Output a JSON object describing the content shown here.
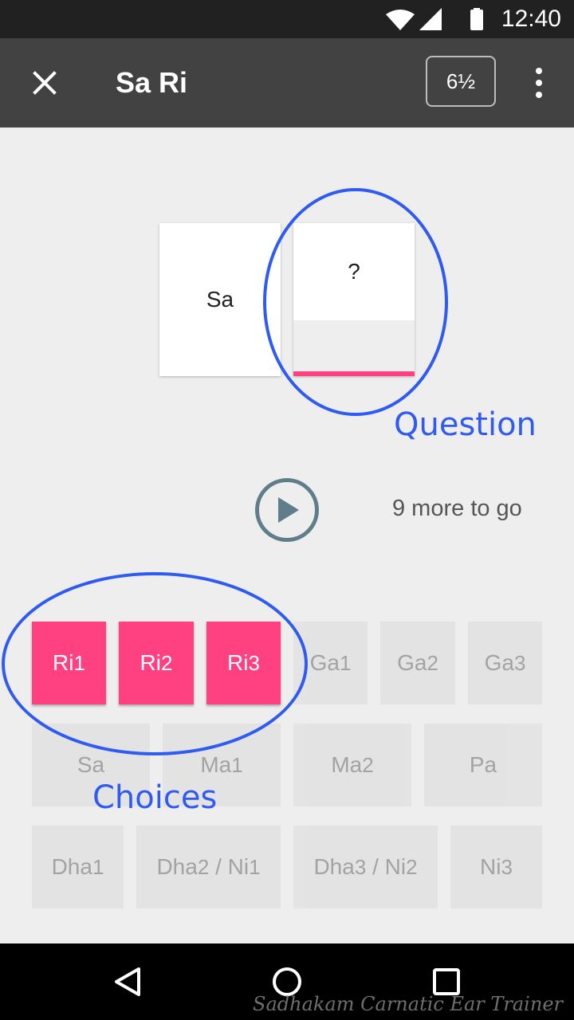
{
  "status_bar": {
    "time": "12:40",
    "icons": [
      "wifi-icon",
      "cellular-signal-icon",
      "battery-icon"
    ]
  },
  "app_bar": {
    "title": "Sa Ri",
    "score": "6½",
    "close_icon": "close-icon",
    "more_icon": "more-vert-icon"
  },
  "cards": {
    "known": "Sa",
    "question": "?"
  },
  "annotations": {
    "question": "Question",
    "choices": "Choices"
  },
  "player": {
    "play_icon": "play-icon",
    "remaining": "9 more to go"
  },
  "choices": [
    {
      "name": "Ri",
      "sub": "1",
      "active": true
    },
    {
      "name": "Ri",
      "sub": "2",
      "active": true
    },
    {
      "name": "Ri",
      "sub": "3",
      "active": true
    },
    {
      "name": "Ga",
      "sub": "1",
      "active": false
    },
    {
      "name": "Ga",
      "sub": "2",
      "active": false
    },
    {
      "name": "Ga",
      "sub": "3",
      "active": false
    },
    {
      "name": "Sa",
      "sub": "",
      "active": false
    },
    {
      "name": "Ma",
      "sub": "1",
      "active": false
    },
    {
      "name": "Ma",
      "sub": "2",
      "active": false
    },
    {
      "name": "Pa",
      "sub": "",
      "active": false
    },
    {
      "name": "Dha",
      "sub": "1",
      "active": false
    },
    {
      "name": "Dha",
      "sub": "2",
      "name2": " / Ni",
      "sub2": "1",
      "active": false
    },
    {
      "name": "Dha",
      "sub": "3",
      "name2": " / Ni",
      "sub2": "2",
      "active": false
    },
    {
      "name": "Ni",
      "sub": "3",
      "active": false
    }
  ],
  "nav_bar": {
    "icons": [
      "back-icon",
      "home-icon",
      "recents-icon"
    ]
  },
  "watermark": "Sadhakam Carnatic Ear Trainer",
  "colors": {
    "accent": "#ff4081",
    "annotation": "#2f5bf2",
    "app_bar": "#424242",
    "status_bar": "#212121"
  }
}
